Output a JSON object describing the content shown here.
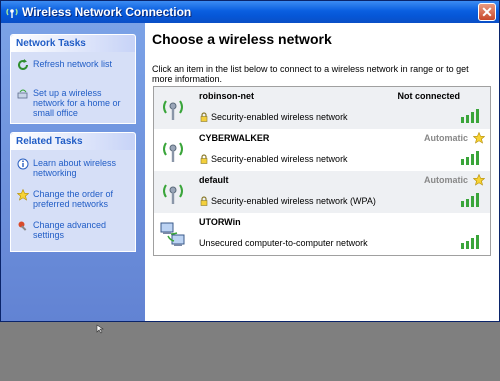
{
  "window": {
    "title": "Wireless Network Connection",
    "close_icon": "close-icon"
  },
  "sidebar": {
    "network_tasks": {
      "title": "Network Tasks",
      "items": [
        {
          "label": "Refresh network list",
          "icon": "refresh-icon"
        },
        {
          "label": "Set up a wireless network for a home or small office",
          "icon": "setup-network-icon"
        }
      ]
    },
    "related_tasks": {
      "title": "Related Tasks",
      "items": [
        {
          "label": "Learn about wireless networking",
          "icon": "info-icon"
        },
        {
          "label": "Change the order of preferred networks",
          "icon": "star-icon"
        },
        {
          "label": "Change advanced settings",
          "icon": "settings-icon"
        }
      ]
    }
  },
  "main": {
    "heading": "Choose a wireless network",
    "instruction": "Click an item in the list below to connect to a wireless network in range or to get more information.",
    "networks": [
      {
        "name": "robinson-net",
        "security": "Security-enabled wireless network",
        "status": "Not connected",
        "secured": true,
        "starred": false,
        "signal_bars": 4
      },
      {
        "name": "CYBERWALKER",
        "security": "Security-enabled wireless network",
        "status": "Automatic",
        "secured": true,
        "starred": true,
        "signal_bars": 4
      },
      {
        "name": "default",
        "security": "Security-enabled wireless network (WPA)",
        "status": "Automatic",
        "secured": true,
        "starred": true,
        "signal_bars": 4
      },
      {
        "name": "UTORWin",
        "security": "Unsecured computer-to-computer network",
        "status": "",
        "secured": false,
        "starred": false,
        "signal_bars": 4
      }
    ]
  },
  "colors": {
    "titlebar": "#0a5fe0",
    "sidebar": "#6f93de",
    "task_link": "#215dc6",
    "automatic": "#888888",
    "signal": "#3aa53a"
  }
}
